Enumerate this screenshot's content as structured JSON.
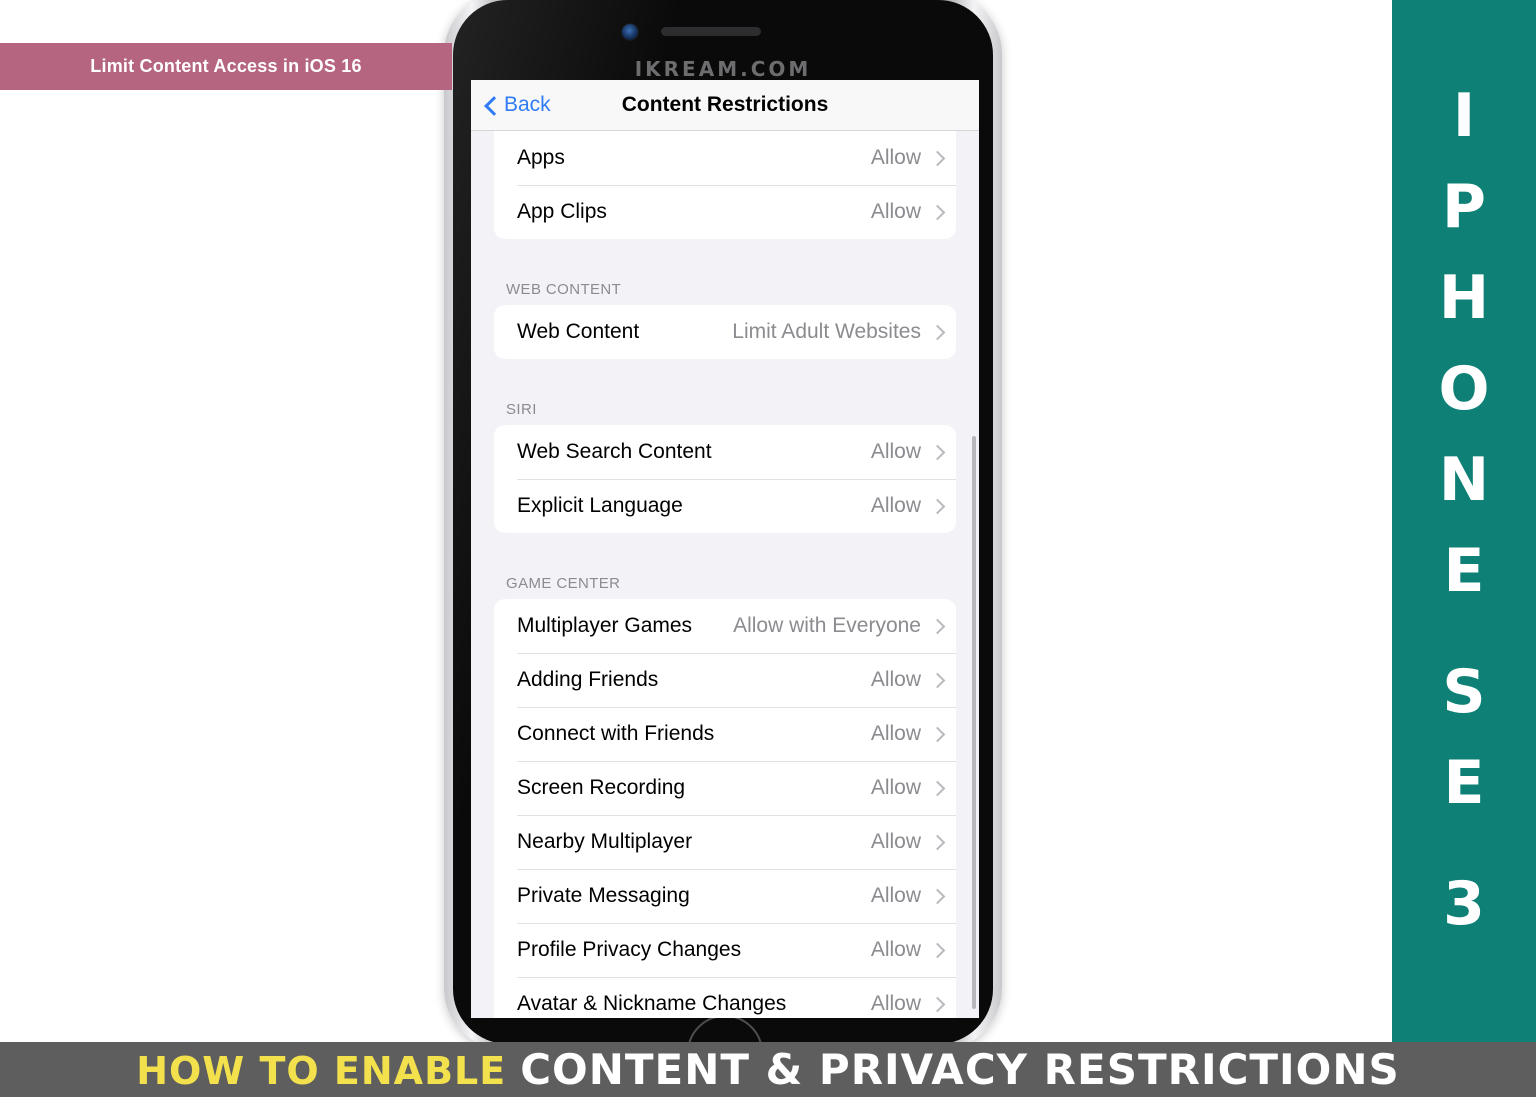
{
  "topic_banner": {
    "label": "Limit Content Access in iOS 16",
    "color": "#b5657f"
  },
  "side_rail": {
    "color": "#0e8076",
    "text": "IPHONE SE 3",
    "chars": [
      "I",
      "P",
      "H",
      "O",
      "N",
      "E",
      "S",
      "E",
      "3"
    ]
  },
  "bottom_bar": {
    "color": "#5e5e5e",
    "lead_text": "HOW TO ENABLE",
    "lead_color": "#f2e14c",
    "main_text": "CONTENT & PRIVACY RESTRICTIONS",
    "main_color": "#ffffff"
  },
  "phone": {
    "watermark": "IKREAM.COM",
    "home_button": "home-button"
  },
  "screen": {
    "nav": {
      "back_label": "Back",
      "back_color": "#2f7cf6",
      "title": "Content Restrictions"
    },
    "sections": [
      {
        "header": "",
        "rows": [
          {
            "label": "Apps",
            "value": "Allow"
          },
          {
            "label": "App Clips",
            "value": "Allow"
          }
        ]
      },
      {
        "header": "WEB CONTENT",
        "rows": [
          {
            "label": "Web Content",
            "value": "Limit Adult Websites"
          }
        ]
      },
      {
        "header": "SIRI",
        "rows": [
          {
            "label": "Web Search Content",
            "value": "Allow"
          },
          {
            "label": "Explicit Language",
            "value": "Allow"
          }
        ]
      },
      {
        "header": "GAME CENTER",
        "rows": [
          {
            "label": "Multiplayer Games",
            "value": "Allow with Everyone"
          },
          {
            "label": "Adding Friends",
            "value": "Allow"
          },
          {
            "label": "Connect with Friends",
            "value": "Allow"
          },
          {
            "label": "Screen Recording",
            "value": "Allow"
          },
          {
            "label": "Nearby Multiplayer",
            "value": "Allow"
          },
          {
            "label": "Private Messaging",
            "value": "Allow"
          },
          {
            "label": "Profile Privacy Changes",
            "value": "Allow"
          },
          {
            "label": "Avatar & Nickname Changes",
            "value": "Allow"
          }
        ]
      }
    ]
  }
}
